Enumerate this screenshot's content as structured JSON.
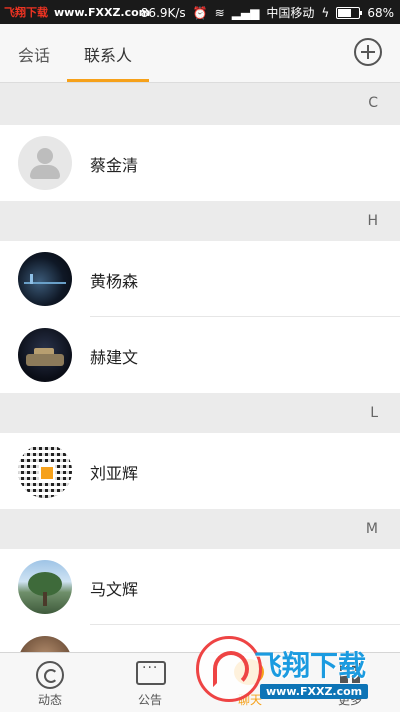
{
  "status_bar": {
    "watermark_cn": "飞翔下载",
    "watermark_url": "www.FXXZ.com",
    "net_speed": "86.9K/s",
    "carrier": "中国移动",
    "battery": "68%",
    "battery_level": 0.68
  },
  "tabs": [
    {
      "label": "会话",
      "active": false
    },
    {
      "label": "联系人",
      "active": true
    }
  ],
  "sections": [
    {
      "letter": "C",
      "contacts": [
        {
          "name": "蔡金清",
          "avatar": "default-avatar"
        }
      ]
    },
    {
      "letter": "H",
      "contacts": [
        {
          "name": "黄杨森",
          "avatar": "night-city-photo"
        },
        {
          "name": "赫建文",
          "avatar": "night-ship-photo"
        }
      ]
    },
    {
      "letter": "L",
      "contacts": [
        {
          "name": "刘亚辉",
          "avatar": "qr-code-photo"
        }
      ]
    },
    {
      "letter": "M",
      "contacts": [
        {
          "name": "马文辉",
          "avatar": "tree-photo"
        }
      ]
    }
  ],
  "bottom_nav": [
    {
      "label": "动态",
      "icon": "activity-icon"
    },
    {
      "label": "公告",
      "icon": "announcement-icon"
    },
    {
      "label": "聊天",
      "icon": "chat-icon",
      "active": true
    },
    {
      "label": "更多",
      "icon": "more-icon"
    }
  ],
  "watermark": {
    "brand": "飞翔下载",
    "url": "www.FXXZ.com"
  },
  "colors": {
    "accent": "#f6a11a",
    "background": "#ebebeb"
  }
}
